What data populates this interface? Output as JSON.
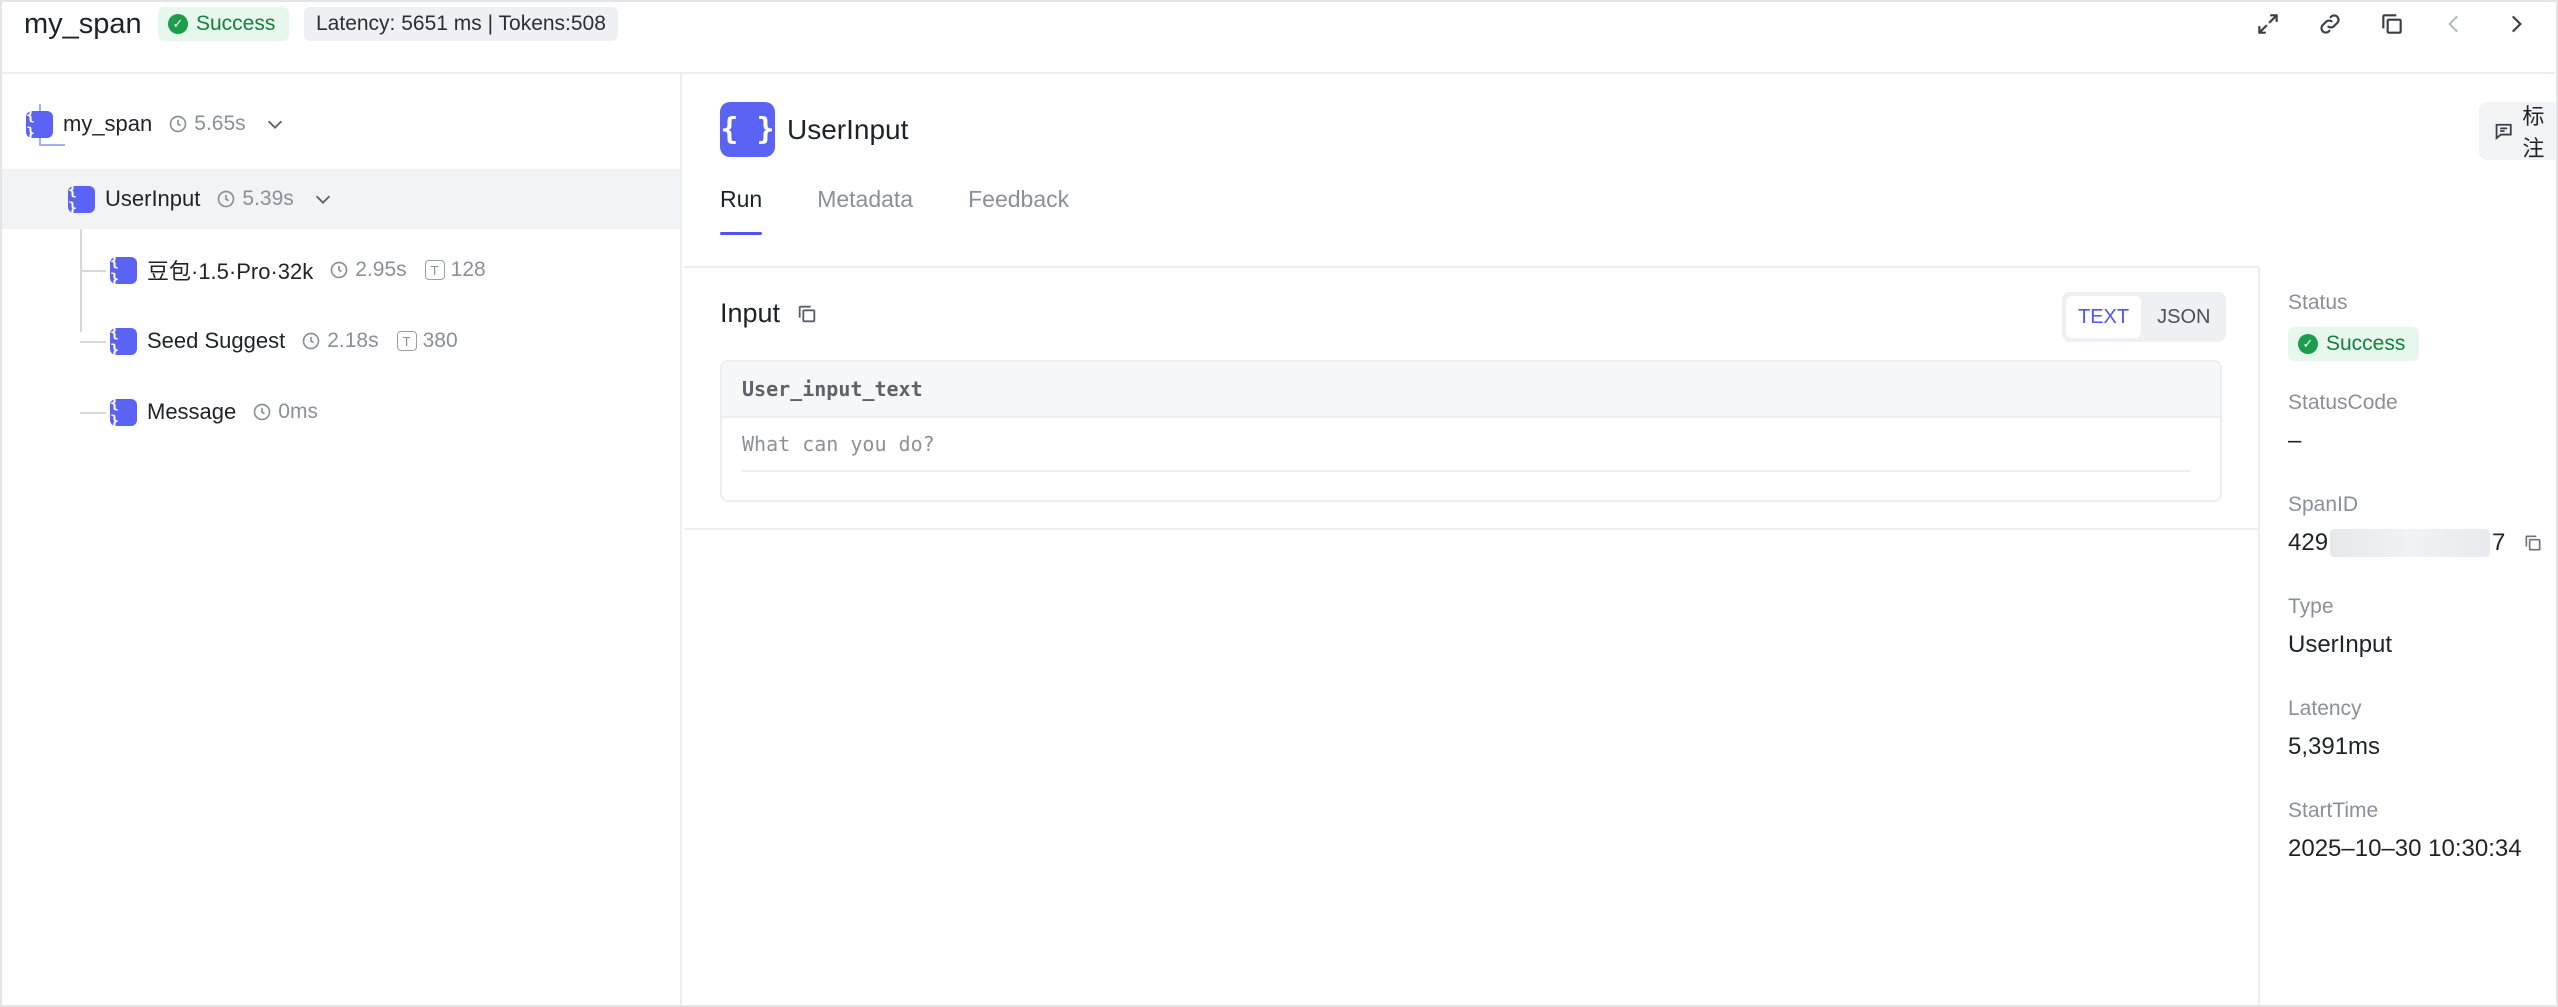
{
  "header": {
    "title": "my_span",
    "status": "Success",
    "meta": "Latency: 5651 ms | Tokens:508",
    "actions": [
      "expand-icon",
      "link-icon",
      "copy-icon",
      "chevron-left-icon",
      "chevron-right-icon"
    ]
  },
  "tree": {
    "nodes": [
      {
        "label": "my_span",
        "duration": "5.65s",
        "tokens": "",
        "expandable": true
      },
      {
        "label": "UserInput",
        "duration": "5.39s",
        "tokens": "",
        "expandable": true,
        "selected": true
      },
      {
        "label": "豆包·1.5·Pro·32k",
        "duration": "2.95s",
        "tokens": "128"
      },
      {
        "label": "Seed Suggest",
        "duration": "2.18s",
        "tokens": "380"
      },
      {
        "label": "Message",
        "duration": "0ms",
        "tokens": ""
      }
    ],
    "icon_glyph": "{ }",
    "token_glyph": "T"
  },
  "panel": {
    "title": "UserInput",
    "annotate_label": "标注",
    "tabs": [
      {
        "label": "Run",
        "active": true
      },
      {
        "label": "Metadata",
        "active": false
      },
      {
        "label": "Feedback",
        "active": false
      }
    ],
    "input": {
      "heading": "Input",
      "formats": [
        "TEXT",
        "JSON"
      ],
      "selected_format": "TEXT",
      "key": "User_input_text",
      "value": "What can you do?"
    }
  },
  "detail": {
    "status_label": "Status",
    "status_value": "Success",
    "statuscode_label": "StatusCode",
    "statuscode_value": "–",
    "spanid_label": "SpanID",
    "spanid_prefix": "429",
    "spanid_suffix": "7",
    "type_label": "Type",
    "type_value": "UserInput",
    "latency_label": "Latency",
    "latency_value": "5,391ms",
    "starttime_label": "StartTime",
    "starttime_value": "2025–10–30 10:30:34"
  },
  "colors": {
    "accent": "#4e55f0",
    "node_icon": "#5b63f5",
    "success_bg": "#e8f7ee",
    "success_fg": "#14803c"
  }
}
